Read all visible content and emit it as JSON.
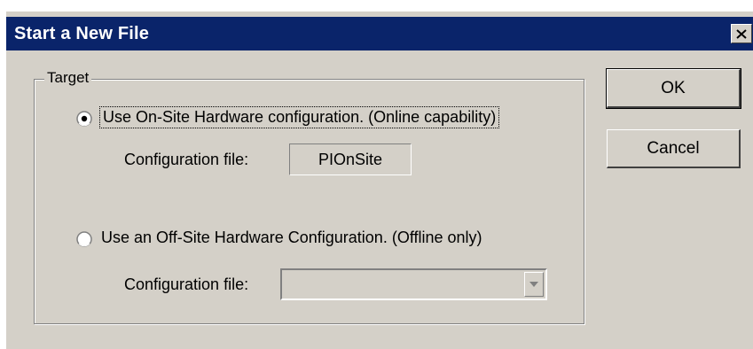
{
  "dialog": {
    "title": "Start a New File",
    "close_icon": "close-x-icon"
  },
  "target_group": {
    "label": "Target",
    "options": [
      {
        "label": "Use On-Site Hardware configuration. (Online capability)",
        "selected": true,
        "config_label": "Configuration file:",
        "config_value": "PIOnSite"
      },
      {
        "label": "Use an Off-Site Hardware Configuration. (Offline only)",
        "selected": false,
        "config_label": "Configuration file:",
        "config_value": "",
        "dropdown_icon": "chevron-down-icon"
      }
    ]
  },
  "buttons": {
    "ok": "OK",
    "cancel": "Cancel"
  },
  "colors": {
    "titlebar": "#0a246a",
    "face": "#d4d0c8"
  }
}
